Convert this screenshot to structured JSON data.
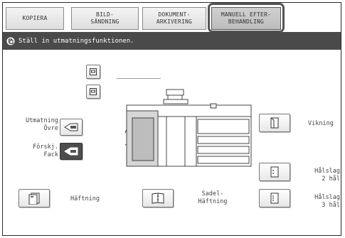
{
  "tabs": [
    {
      "label": "KOPIERA"
    },
    {
      "label": "BILD-\nSÄNDNING"
    },
    {
      "label": "DOKUMENT-\nARKIVERING"
    },
    {
      "label": "MANUELL EFTER-\nBEHANDLING"
    }
  ],
  "message": "Ställ in utmatningsfunktionen.",
  "output": {
    "top_label": "Utmatning\nÖvre",
    "offset_label": "Förskj.\nFack"
  },
  "functions": {
    "stapling": "Häftning",
    "saddle_stitch": "Sadel-\nHäftning",
    "folding": "Vikning",
    "punch2": "Hålslag\n2 hål",
    "punch3": "Hålslag\n3 hål"
  }
}
